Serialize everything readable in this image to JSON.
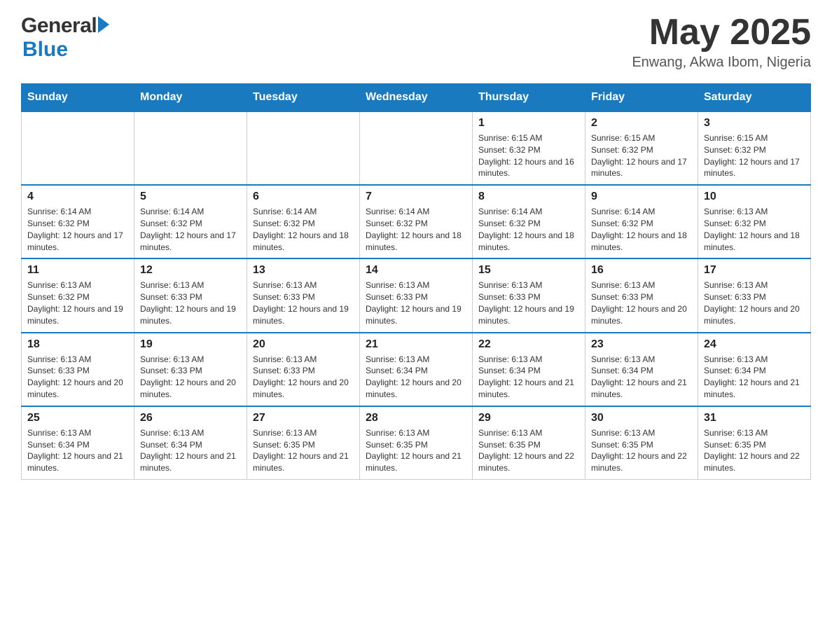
{
  "header": {
    "logo_general": "General",
    "logo_blue": "Blue",
    "month_title": "May 2025",
    "location": "Enwang, Akwa Ibom, Nigeria"
  },
  "calendar": {
    "days_of_week": [
      "Sunday",
      "Monday",
      "Tuesday",
      "Wednesday",
      "Thursday",
      "Friday",
      "Saturday"
    ],
    "weeks": [
      {
        "days": [
          {
            "number": "",
            "info": ""
          },
          {
            "number": "",
            "info": ""
          },
          {
            "number": "",
            "info": ""
          },
          {
            "number": "",
            "info": ""
          },
          {
            "number": "1",
            "info": "Sunrise: 6:15 AM\nSunset: 6:32 PM\nDaylight: 12 hours and 16 minutes."
          },
          {
            "number": "2",
            "info": "Sunrise: 6:15 AM\nSunset: 6:32 PM\nDaylight: 12 hours and 17 minutes."
          },
          {
            "number": "3",
            "info": "Sunrise: 6:15 AM\nSunset: 6:32 PM\nDaylight: 12 hours and 17 minutes."
          }
        ]
      },
      {
        "days": [
          {
            "number": "4",
            "info": "Sunrise: 6:14 AM\nSunset: 6:32 PM\nDaylight: 12 hours and 17 minutes."
          },
          {
            "number": "5",
            "info": "Sunrise: 6:14 AM\nSunset: 6:32 PM\nDaylight: 12 hours and 17 minutes."
          },
          {
            "number": "6",
            "info": "Sunrise: 6:14 AM\nSunset: 6:32 PM\nDaylight: 12 hours and 18 minutes."
          },
          {
            "number": "7",
            "info": "Sunrise: 6:14 AM\nSunset: 6:32 PM\nDaylight: 12 hours and 18 minutes."
          },
          {
            "number": "8",
            "info": "Sunrise: 6:14 AM\nSunset: 6:32 PM\nDaylight: 12 hours and 18 minutes."
          },
          {
            "number": "9",
            "info": "Sunrise: 6:14 AM\nSunset: 6:32 PM\nDaylight: 12 hours and 18 minutes."
          },
          {
            "number": "10",
            "info": "Sunrise: 6:13 AM\nSunset: 6:32 PM\nDaylight: 12 hours and 18 minutes."
          }
        ]
      },
      {
        "days": [
          {
            "number": "11",
            "info": "Sunrise: 6:13 AM\nSunset: 6:32 PM\nDaylight: 12 hours and 19 minutes."
          },
          {
            "number": "12",
            "info": "Sunrise: 6:13 AM\nSunset: 6:33 PM\nDaylight: 12 hours and 19 minutes."
          },
          {
            "number": "13",
            "info": "Sunrise: 6:13 AM\nSunset: 6:33 PM\nDaylight: 12 hours and 19 minutes."
          },
          {
            "number": "14",
            "info": "Sunrise: 6:13 AM\nSunset: 6:33 PM\nDaylight: 12 hours and 19 minutes."
          },
          {
            "number": "15",
            "info": "Sunrise: 6:13 AM\nSunset: 6:33 PM\nDaylight: 12 hours and 19 minutes."
          },
          {
            "number": "16",
            "info": "Sunrise: 6:13 AM\nSunset: 6:33 PM\nDaylight: 12 hours and 20 minutes."
          },
          {
            "number": "17",
            "info": "Sunrise: 6:13 AM\nSunset: 6:33 PM\nDaylight: 12 hours and 20 minutes."
          }
        ]
      },
      {
        "days": [
          {
            "number": "18",
            "info": "Sunrise: 6:13 AM\nSunset: 6:33 PM\nDaylight: 12 hours and 20 minutes."
          },
          {
            "number": "19",
            "info": "Sunrise: 6:13 AM\nSunset: 6:33 PM\nDaylight: 12 hours and 20 minutes."
          },
          {
            "number": "20",
            "info": "Sunrise: 6:13 AM\nSunset: 6:33 PM\nDaylight: 12 hours and 20 minutes."
          },
          {
            "number": "21",
            "info": "Sunrise: 6:13 AM\nSunset: 6:34 PM\nDaylight: 12 hours and 20 minutes."
          },
          {
            "number": "22",
            "info": "Sunrise: 6:13 AM\nSunset: 6:34 PM\nDaylight: 12 hours and 21 minutes."
          },
          {
            "number": "23",
            "info": "Sunrise: 6:13 AM\nSunset: 6:34 PM\nDaylight: 12 hours and 21 minutes."
          },
          {
            "number": "24",
            "info": "Sunrise: 6:13 AM\nSunset: 6:34 PM\nDaylight: 12 hours and 21 minutes."
          }
        ]
      },
      {
        "days": [
          {
            "number": "25",
            "info": "Sunrise: 6:13 AM\nSunset: 6:34 PM\nDaylight: 12 hours and 21 minutes."
          },
          {
            "number": "26",
            "info": "Sunrise: 6:13 AM\nSunset: 6:34 PM\nDaylight: 12 hours and 21 minutes."
          },
          {
            "number": "27",
            "info": "Sunrise: 6:13 AM\nSunset: 6:35 PM\nDaylight: 12 hours and 21 minutes."
          },
          {
            "number": "28",
            "info": "Sunrise: 6:13 AM\nSunset: 6:35 PM\nDaylight: 12 hours and 21 minutes."
          },
          {
            "number": "29",
            "info": "Sunrise: 6:13 AM\nSunset: 6:35 PM\nDaylight: 12 hours and 22 minutes."
          },
          {
            "number": "30",
            "info": "Sunrise: 6:13 AM\nSunset: 6:35 PM\nDaylight: 12 hours and 22 minutes."
          },
          {
            "number": "31",
            "info": "Sunrise: 6:13 AM\nSunset: 6:35 PM\nDaylight: 12 hours and 22 minutes."
          }
        ]
      }
    ]
  }
}
